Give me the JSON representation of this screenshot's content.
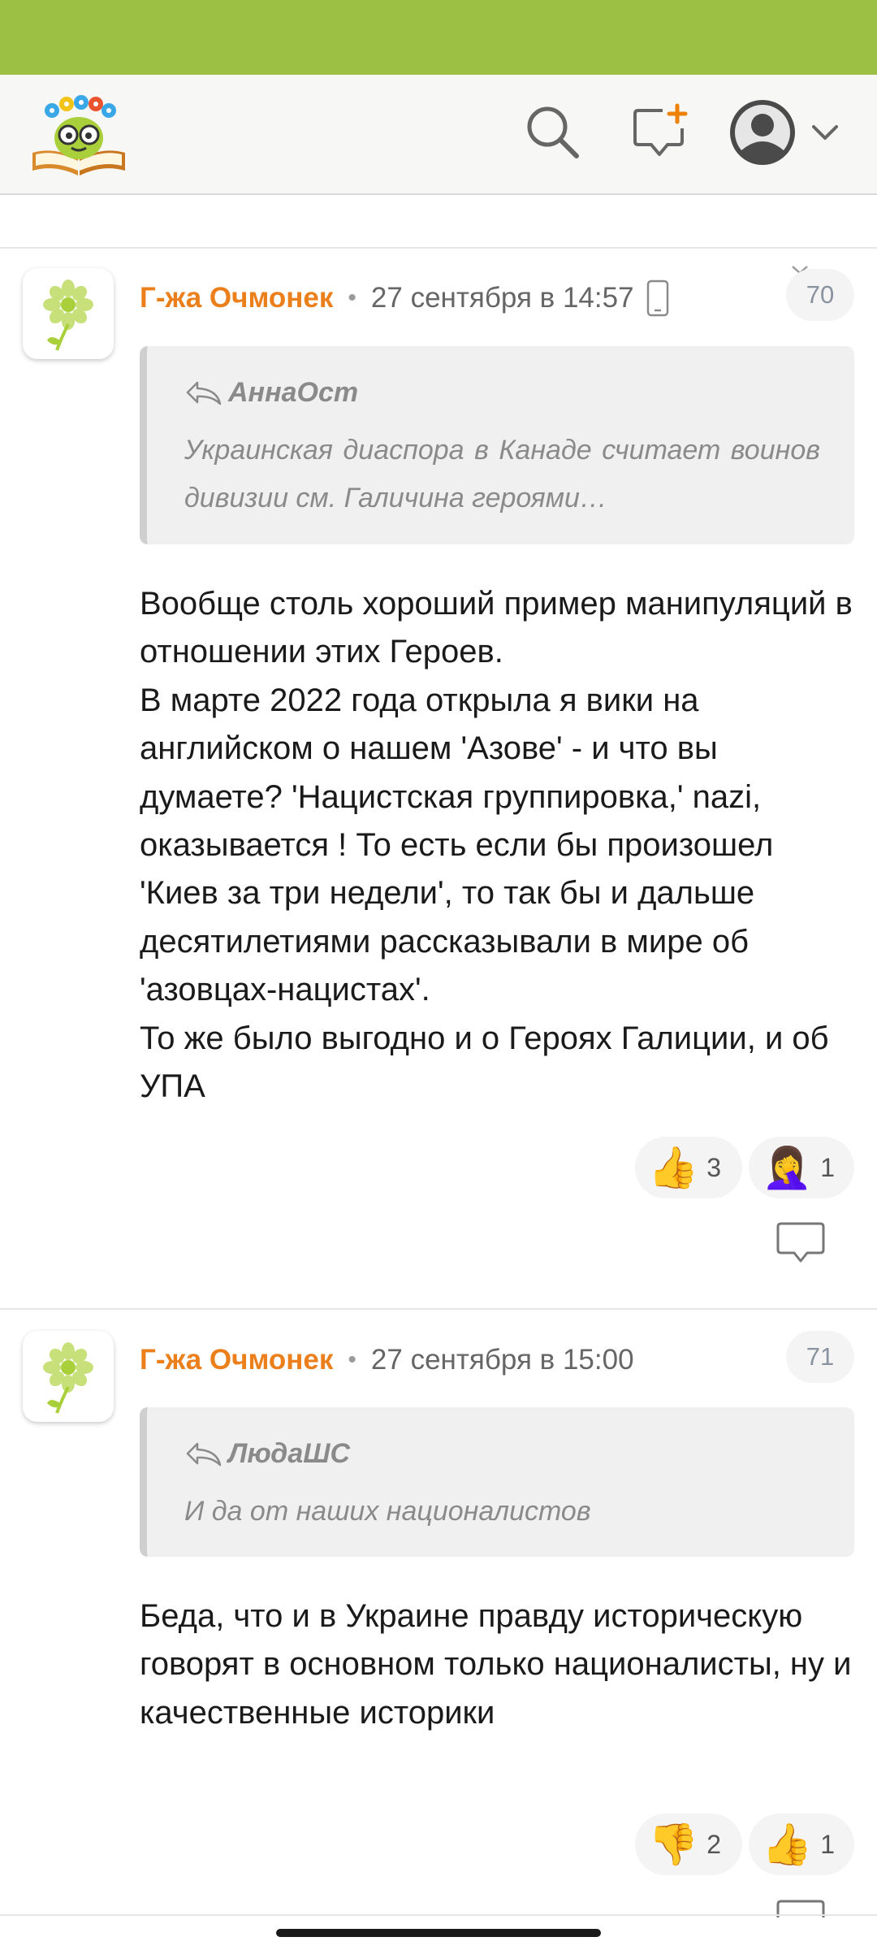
{
  "colors": {
    "status_bar": "#9cc043",
    "author": "#eb7f1b",
    "header_bg": "#f7f7f5",
    "quote_bg": "#f0f0f0"
  },
  "header": {
    "logo_icon": "odnoklassniki-book-flower-logo",
    "search_icon": "search-icon",
    "compose_icon": "new-message-icon",
    "profile_icon": "user-avatar-icon",
    "dropdown_icon": "chevron-down-icon"
  },
  "comments": [
    {
      "author": "Г-жа Очмонек",
      "date": "27 сентября в 14:57",
      "device_icon": "mobile-phone-icon",
      "number": "70",
      "quote": {
        "author": "АннаОст",
        "text": "Украинская диаспора в Канаде считает воинов дивизии см. Галичина героями…"
      },
      "body": "Вообще столь хороший пример манипуляций в отношении этих Героев.\nВ марте 2022 года открыла я вики на английском о нашем 'Азове' - и что вы думаете? 'Нацистская группировка,' nazi, оказывается ! То есть если бы произошел 'Киев за три недели', то так бы и дальше десятилетиями рассказывали в мире об 'азовцах-нацистах'.\nТо же было выгодно и о Героях Галиции, и об УПА",
      "reactions": [
        {
          "emoji": "👍",
          "name": "thumbs-up",
          "count": "3"
        },
        {
          "emoji": "🤦‍♀️",
          "name": "facepalm",
          "count": "1"
        }
      ]
    },
    {
      "author": "Г-жа Очмонек",
      "date": "27 сентября в 15:00",
      "number": "71",
      "quote": {
        "author": "ЛюдаШС",
        "text": "И да от наших националистов"
      },
      "body": "Беда, что и в Украине правду историческую говорят в основном только националисты, ну и качественные историки",
      "reactions": [
        {
          "emoji": "👎",
          "name": "thumbs-down",
          "count": "2"
        },
        {
          "emoji": "👍",
          "name": "thumbs-up",
          "count": "1"
        }
      ]
    }
  ]
}
